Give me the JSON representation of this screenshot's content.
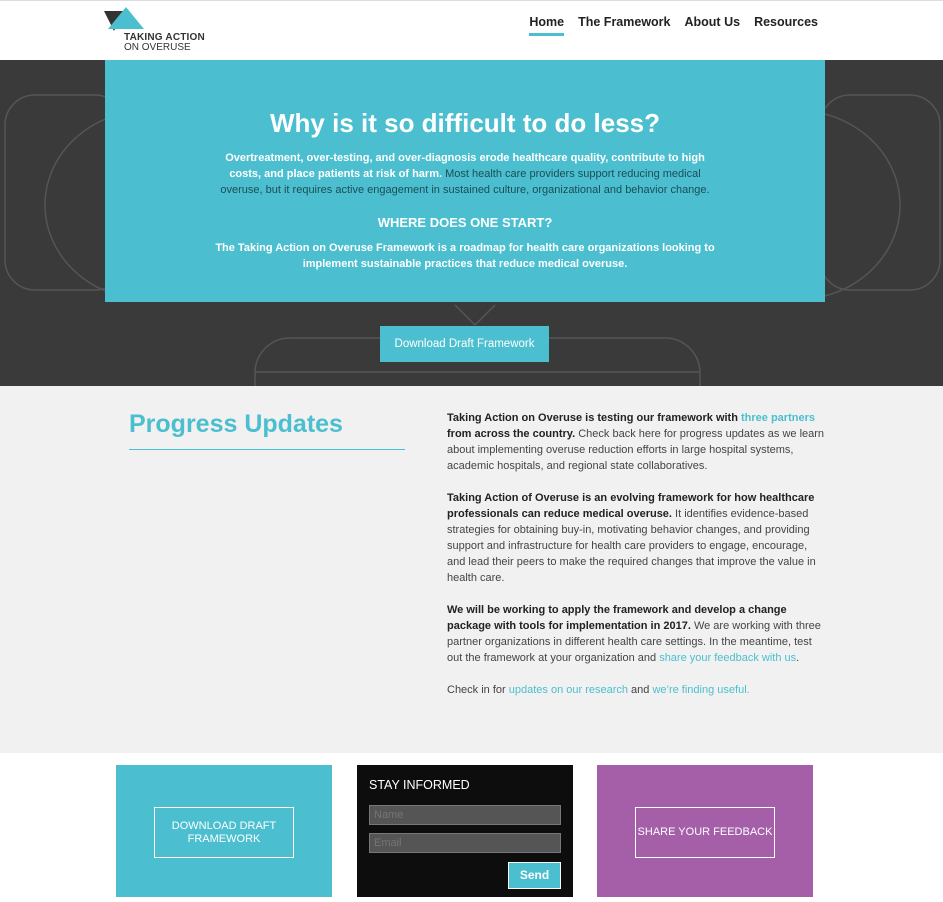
{
  "header": {
    "logo_line1": "TAKING ACTION",
    "logo_line2": "ON OVERUSE",
    "nav": [
      "Home",
      "The Framework",
      "About Us",
      "Resources"
    ],
    "active_nav": "Home"
  },
  "hero": {
    "title": "Why is it so difficult to do less?",
    "para_bold": "Overtreatment, over-testing, and over-diagnosis erode healthcare quality, contribute to high costs, and place patients at risk of harm.",
    "para_normal": " Most health care providers support reducing medical overuse, but it requires active engagement in sustained culture, organizational and behavior change.",
    "subheading": "WHERE DOES ONE START?",
    "para2": "The Taking Action on Overuse Framework is a roadmap for health care organizations looking to implement sustainable practices that reduce medical overuse.",
    "button": "Download Draft Framework"
  },
  "progress": {
    "title": "Progress Updates",
    "p1_bold1": "Taking Action on Overuse is testing our framework with ",
    "p1_link": "three partners",
    "p1_bold2": " from across the country.",
    "p1_rest": " Check back here for progress updates as we learn about implementing overuse reduction efforts in large hospital systems, academic hospitals, and regional state collaboratives.",
    "p2_bold": "Taking Action of Overuse is an evolving framework for how healthcare professionals can reduce medical overuse.",
    "p2_rest": " It identifies evidence-based strategies for obtaining buy-in, motivating behavior changes, and providing support and infrastructure for health care providers to engage, encourage, and lead their peers to make the required changes that improve the value in health care.",
    "p3_bold": "We will be working to apply the framework and develop a change package with tools for implementation in 2017.",
    "p3_rest": " We are working with three partner organizations in different health care settings. In the meantime, test out the framework at your organization and ",
    "p3_link": "share your feedback with us",
    "p3_end": ".",
    "p4_start": "Check in for ",
    "p4_link1": "updates on our research",
    "p4_mid": " and ",
    "p4_link2": "we’re finding useful."
  },
  "cards": {
    "download_label": "DOWNLOAD DRAFT FRAMEWORK",
    "stay_title": "STAY INFORMED",
    "name_placeholder": "Name",
    "email_placeholder": "Email",
    "send_label": "Send",
    "feedback_label": "SHARE YOUR FEEDBACK"
  },
  "colors": {
    "accent": "#4bbfcf",
    "hero_bg": "#3a3a3a",
    "feedback_purple": "#a45fa8"
  }
}
